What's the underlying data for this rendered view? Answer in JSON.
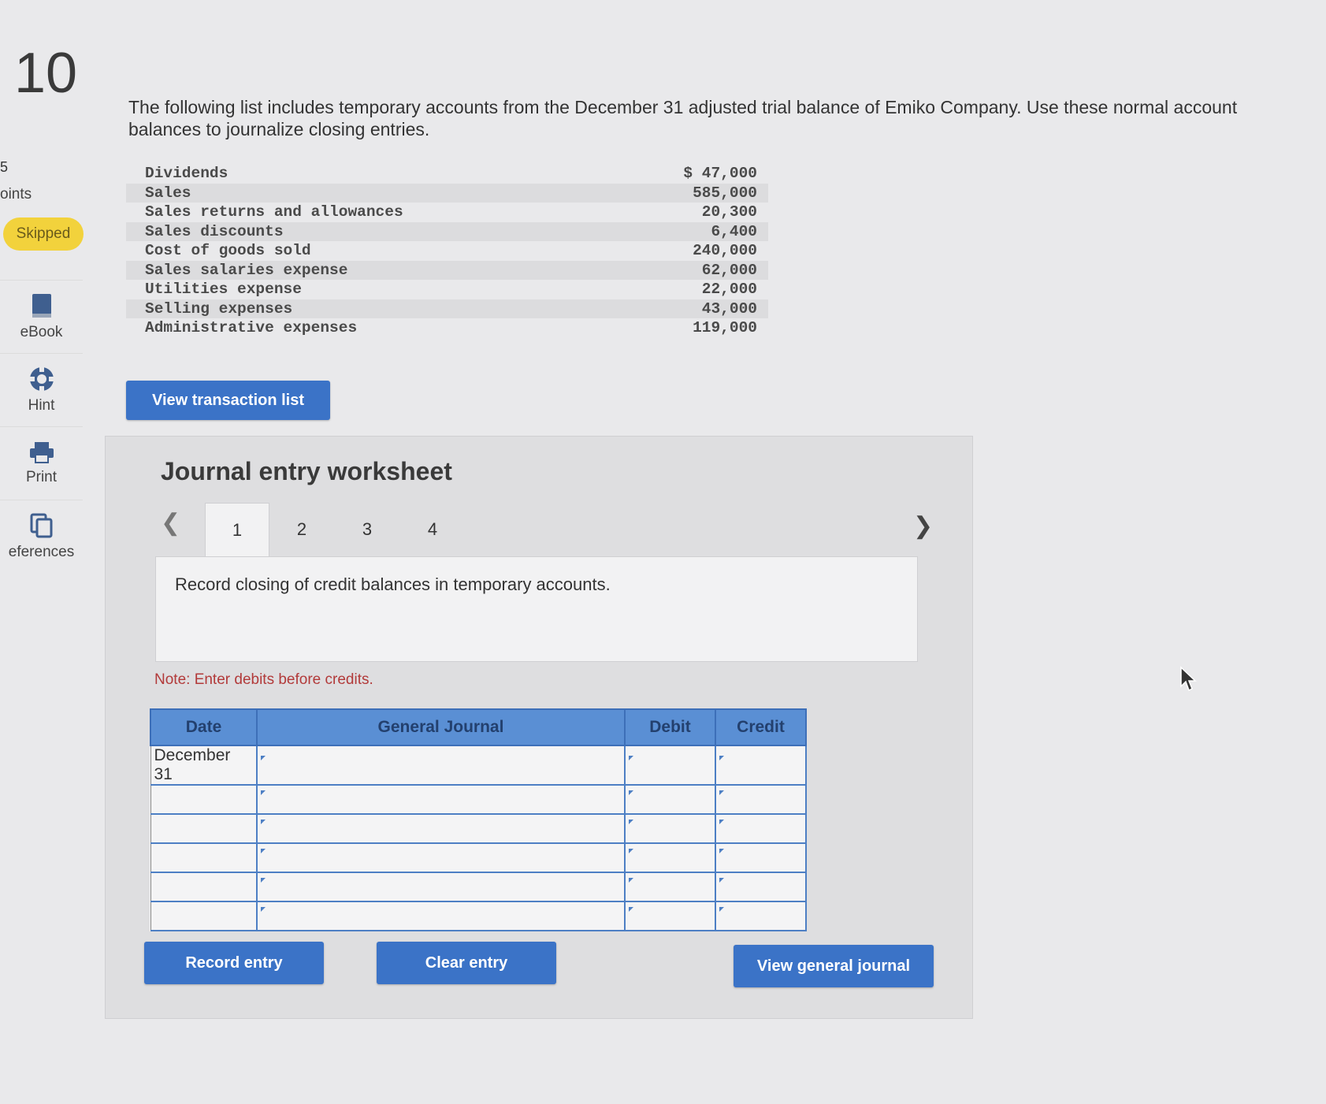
{
  "sidebar": {
    "question_number": "10",
    "points_number": "5",
    "points_label": "oints",
    "status_badge": "Skipped",
    "tools": [
      {
        "label": "eBook",
        "icon": "book-icon"
      },
      {
        "label": "Hint",
        "icon": "lifebuoy-icon"
      },
      {
        "label": "Print",
        "icon": "printer-icon"
      },
      {
        "label": "eferences",
        "icon": "copy-icon"
      }
    ]
  },
  "question": {
    "text": "The following list includes temporary accounts from the December 31 adjusted trial balance of Emiko Company. Use these normal account balances to journalize closing entries."
  },
  "accounts": [
    {
      "name": "Dividends",
      "amount": "$ 47,000"
    },
    {
      "name": "Sales",
      "amount": "585,000"
    },
    {
      "name": "Sales returns and allowances",
      "amount": "20,300"
    },
    {
      "name": "Sales discounts",
      "amount": "6,400"
    },
    {
      "name": "Cost of goods sold",
      "amount": "240,000"
    },
    {
      "name": "Sales salaries expense",
      "amount": "62,000"
    },
    {
      "name": "Utilities expense",
      "amount": "22,000"
    },
    {
      "name": "Selling expenses",
      "amount": "43,000"
    },
    {
      "name": "Administrative expenses",
      "amount": "119,000"
    }
  ],
  "buttons": {
    "view_transaction_list": "View transaction list",
    "record_entry": "Record entry",
    "clear_entry": "Clear entry",
    "view_general_journal": "View general journal"
  },
  "worksheet": {
    "title": "Journal entry worksheet",
    "tabs": [
      "1",
      "2",
      "3",
      "4"
    ],
    "active_tab": "1",
    "instruction": "Record closing of credit balances in temporary accounts.",
    "note": "Note: Enter debits before credits."
  },
  "journal": {
    "headers": {
      "date": "Date",
      "account": "General Journal",
      "debit": "Debit",
      "credit": "Credit"
    },
    "rows": [
      {
        "date": "December 31",
        "account": "",
        "debit": "",
        "credit": ""
      },
      {
        "date": "",
        "account": "",
        "debit": "",
        "credit": ""
      },
      {
        "date": "",
        "account": "",
        "debit": "",
        "credit": ""
      },
      {
        "date": "",
        "account": "",
        "debit": "",
        "credit": ""
      },
      {
        "date": "",
        "account": "",
        "debit": "",
        "credit": ""
      },
      {
        "date": "",
        "account": "",
        "debit": "",
        "credit": ""
      }
    ]
  },
  "colors": {
    "accent": "#3b73c7",
    "header": "#5a8fd4",
    "badge": "#f2d23c",
    "note": "#b23a3a"
  }
}
